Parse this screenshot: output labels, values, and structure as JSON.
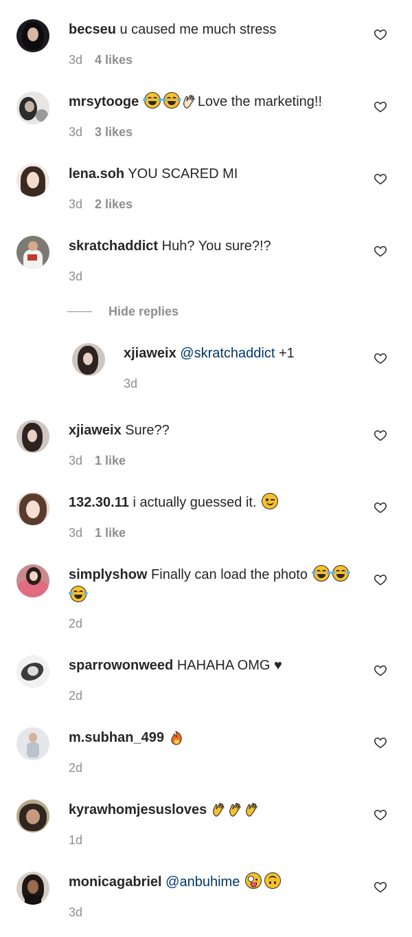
{
  "hide_replies_label": "Hide replies",
  "comments": [
    {
      "user": "becseu",
      "text": "u caused me much stress",
      "time": "3d",
      "likes": "4 likes",
      "avatar": "avatar"
    },
    {
      "user": "mrsytooge",
      "text": "Love the marketing!!",
      "time": "3d",
      "likes": "3 likes",
      "avatar": "avatar",
      "emojis_before_text": [
        "face-with-tears-of-joy",
        "face-with-tears-of-joy",
        "clapping-hands"
      ]
    },
    {
      "user": "lena.soh",
      "text": "YOU SCARED MI",
      "time": "3d",
      "likes": "2 likes",
      "avatar": "avatar"
    },
    {
      "user": "skratchaddict",
      "text": "Huh? You sure?!?",
      "time": "3d",
      "likes": "",
      "avatar": "avatar"
    },
    {
      "user": "xjiaweix",
      "mention": "@skratchaddict",
      "text": "+1",
      "time": "3d",
      "likes": "",
      "is_reply": true,
      "avatar": "avatar"
    },
    {
      "user": "xjiaweix",
      "text": "Sure??",
      "time": "3d",
      "likes": "1 like",
      "avatar": "avatar"
    },
    {
      "user": "132.30.11",
      "text": "i actually guessed it.",
      "time": "3d",
      "likes": "1 like",
      "avatar": "avatar",
      "emojis_after_text": [
        "winking-face"
      ]
    },
    {
      "user": "simplyshow",
      "text": "Finally can load the photo",
      "time": "2d",
      "likes": "",
      "avatar": "avatar",
      "emojis_after_text": [
        "face-with-tears-of-joy",
        "face-with-tears-of-joy",
        "face-with-tears-of-joy"
      ]
    },
    {
      "user": "sparrowonweed",
      "text": "HAHAHA OMG ♥",
      "time": "2d",
      "likes": "",
      "avatar": "avatar"
    },
    {
      "user": "m.subhan_499",
      "text": "",
      "time": "2d",
      "likes": "",
      "avatar": "avatar",
      "emojis_after_text": [
        "fire"
      ]
    },
    {
      "user": "kyrawhomjesusloves",
      "text": "",
      "time": "1d",
      "likes": "",
      "avatar": "avatar",
      "emojis_after_text": [
        "clapping-hands",
        "clapping-hands",
        "clapping-hands"
      ]
    },
    {
      "user": "monicagabriel",
      "mention": "@anbuhime",
      "text": "",
      "time": "3d",
      "likes": "",
      "avatar": "avatar",
      "emojis_after_text": [
        "zany-face",
        "upside-down-face"
      ]
    }
  ],
  "colors": {
    "username": "#262626",
    "mention": "#00376b",
    "meta": "#8e8e8e"
  },
  "icons": {
    "like": "heart-outline-icon"
  }
}
